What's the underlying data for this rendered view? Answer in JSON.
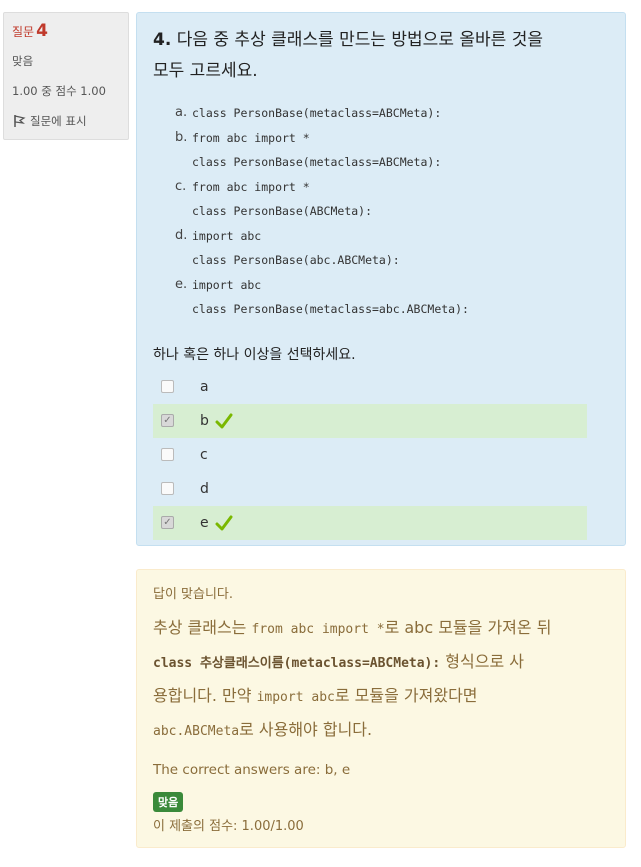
{
  "info": {
    "question_label": "질문",
    "question_number": "4",
    "state": "맞음",
    "grade": "1.00 중 점수 1.00",
    "flag_label": "질문에 표시"
  },
  "question": {
    "number": "4.",
    "text_line1": "다음 중 추상 클래스를 만드는 방법으로 올바른 것을",
    "text_line2": "모두 고르세요.",
    "options": [
      {
        "letter": "a.",
        "lines": [
          "class PersonBase(metaclass=ABCMeta):"
        ]
      },
      {
        "letter": "b.",
        "lines": [
          "from abc import *",
          "class PersonBase(metaclass=ABCMeta):"
        ]
      },
      {
        "letter": "c.",
        "lines": [
          "from abc import *",
          "class PersonBase(ABCMeta):"
        ]
      },
      {
        "letter": "d.",
        "lines": [
          "import abc",
          "class PersonBase(abc.ABCMeta):"
        ]
      },
      {
        "letter": "e.",
        "lines": [
          "import abc",
          "class PersonBase(metaclass=abc.ABCMeta):"
        ]
      }
    ],
    "prompt": "하나 혹은 하나 이상을 선택하세요.",
    "answers": [
      {
        "label": "a",
        "checked": false,
        "correct": false
      },
      {
        "label": "b",
        "checked": true,
        "correct": true
      },
      {
        "label": "c",
        "checked": false,
        "correct": false
      },
      {
        "label": "d",
        "checked": false,
        "correct": false
      },
      {
        "label": "e",
        "checked": true,
        "correct": true
      }
    ]
  },
  "feedback": {
    "head": "답이 맞습니다.",
    "p1_a": "추상 클래스는 ",
    "p1_code": "from abc import *",
    "p1_b": "로 abc 모듈을 가져온 뒤",
    "p2_code": "class 추상클래스이름(metaclass=ABCMeta):",
    "p2_b": " 형식으로 사",
    "p3_a": "용합니다. 만약 ",
    "p3_code": "import abc",
    "p3_b": "로 모듈을 가져왔다면",
    "p4_code": "abc.ABCMeta",
    "p4_b": "로 사용해야 합니다.",
    "right_answer": "The correct answers are: b, e",
    "badge": "맞음",
    "score": "이 제출의 점수: 1.00/1.00"
  },
  "colors": {
    "correct_bg": "#d7eed2",
    "tick": "#7ab800",
    "badge": "#3a8a3a"
  }
}
